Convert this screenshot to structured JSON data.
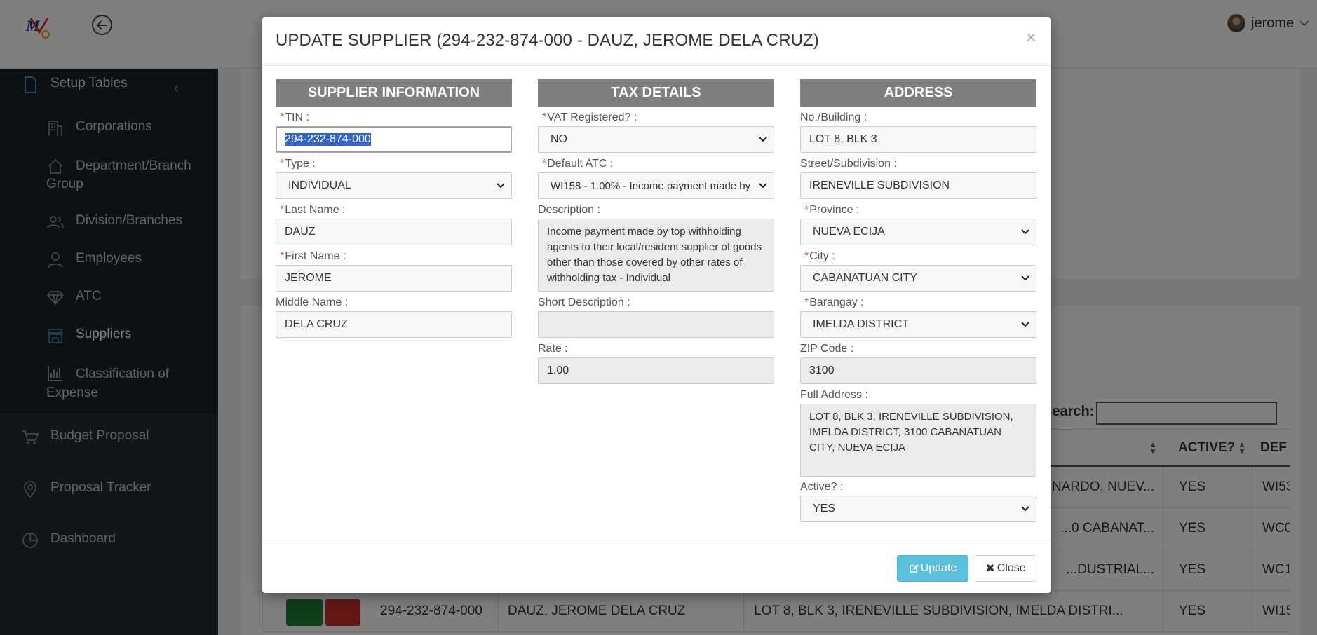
{
  "app": {
    "user_name": "jerome",
    "search_label": "Search:"
  },
  "sidebar": {
    "header": "Setup Tables",
    "items": [
      {
        "label": "Corporations",
        "icon": "building-icon"
      },
      {
        "label": "Department/Branch Group",
        "icon": "home-icon"
      },
      {
        "label": "Division/Branches",
        "icon": "users-icon"
      },
      {
        "label": "Employees",
        "icon": "user-icon"
      },
      {
        "label": "ATC",
        "icon": "diamond-icon"
      },
      {
        "label": "Suppliers",
        "icon": "store-icon"
      },
      {
        "label": "Classification of Expense",
        "icon": "chart-icon"
      }
    ],
    "bottom": [
      {
        "label": "Budget Proposal",
        "icon": "cart-icon"
      },
      {
        "label": "Proposal Tracker",
        "icon": "map-pin-icon"
      },
      {
        "label": "Dashboard",
        "icon": "pie-chart-icon"
      }
    ]
  },
  "table": {
    "headers": {
      "active": "ACTIVE?",
      "default_atc": "DEF"
    },
    "rows": [
      {
        "tin": "",
        "name": "",
        "address": "...NARDO, NUEV...",
        "active": "YES",
        "atc": "WI53"
      },
      {
        "tin": "",
        "name": "",
        "address": "...0 CABANAT...",
        "active": "YES",
        "atc": "WC0"
      },
      {
        "tin": "",
        "name": "",
        "address": "...DUSTRIAL...",
        "active": "YES",
        "atc": "WC1"
      },
      {
        "tin": "294-232-874-000",
        "name": "DAUZ, JEROME DELA CRUZ",
        "address": "LOT 8, BLK 3, IRENEVILLE SUBDIVISION, IMELDA DISTRI...",
        "active": "YES",
        "atc": "WI15"
      }
    ]
  },
  "modal": {
    "title": "UPDATE SUPPLIER (294-232-874-000 - DAUZ, JEROME DELA CRUZ)",
    "close_glyph": "×",
    "supplier": {
      "heading": "SUPPLIER INFORMATION",
      "tin_label": "TIN :",
      "tin": "294-232-874-000",
      "type_label": "Type :",
      "type": "INDIVIDUAL",
      "last_name_label": "Last Name :",
      "last_name": "DAUZ",
      "first_name_label": "First Name :",
      "first_name": "JEROME",
      "middle_name_label": "Middle Name :",
      "middle_name": "DELA CRUZ"
    },
    "tax": {
      "heading": "TAX DETAILS",
      "vat_label": "VAT Registered? :",
      "vat": "NO",
      "atc_label": "Default ATC :",
      "atc": "WI158 - 1.00% - Income payment made by",
      "description_label": "Description :",
      "description": "Income payment made by top withholding agents to their local/resident supplier of goods other than those covered by other rates of withholding tax - Individual",
      "short_description_label": "Short Description :",
      "short_description": "",
      "rate_label": "Rate :",
      "rate": "1.00"
    },
    "address": {
      "heading": "ADDRESS",
      "building_label": "No./Building :",
      "building": "LOT 8, BLK 3",
      "street_label": "Street/Subdivision :",
      "street": "IRENEVILLE SUBDIVISION",
      "province_label": "Province :",
      "province": "NUEVA ECIJA",
      "city_label": "City :",
      "city": "CABANATUAN CITY",
      "barangay_label": "Barangay :",
      "barangay": "IMELDA DISTRICT",
      "zip_label": "ZIP Code :",
      "zip": "3100",
      "full_label": "Full Address :",
      "full": "LOT 8, BLK 3, IRENEVILLE SUBDIVISION, IMELDA DISTRICT, 3100 CABANATUAN CITY, NUEVA ECIJA",
      "active_label": "Active? :",
      "active": "YES"
    },
    "footer": {
      "update_label": "Update",
      "close_label": "Close"
    }
  },
  "colors": {
    "header_bg": "#7f7f7f",
    "update_btn": "#5bc0de",
    "sidebar_bg": "#222d32",
    "required": "#d9534f"
  }
}
